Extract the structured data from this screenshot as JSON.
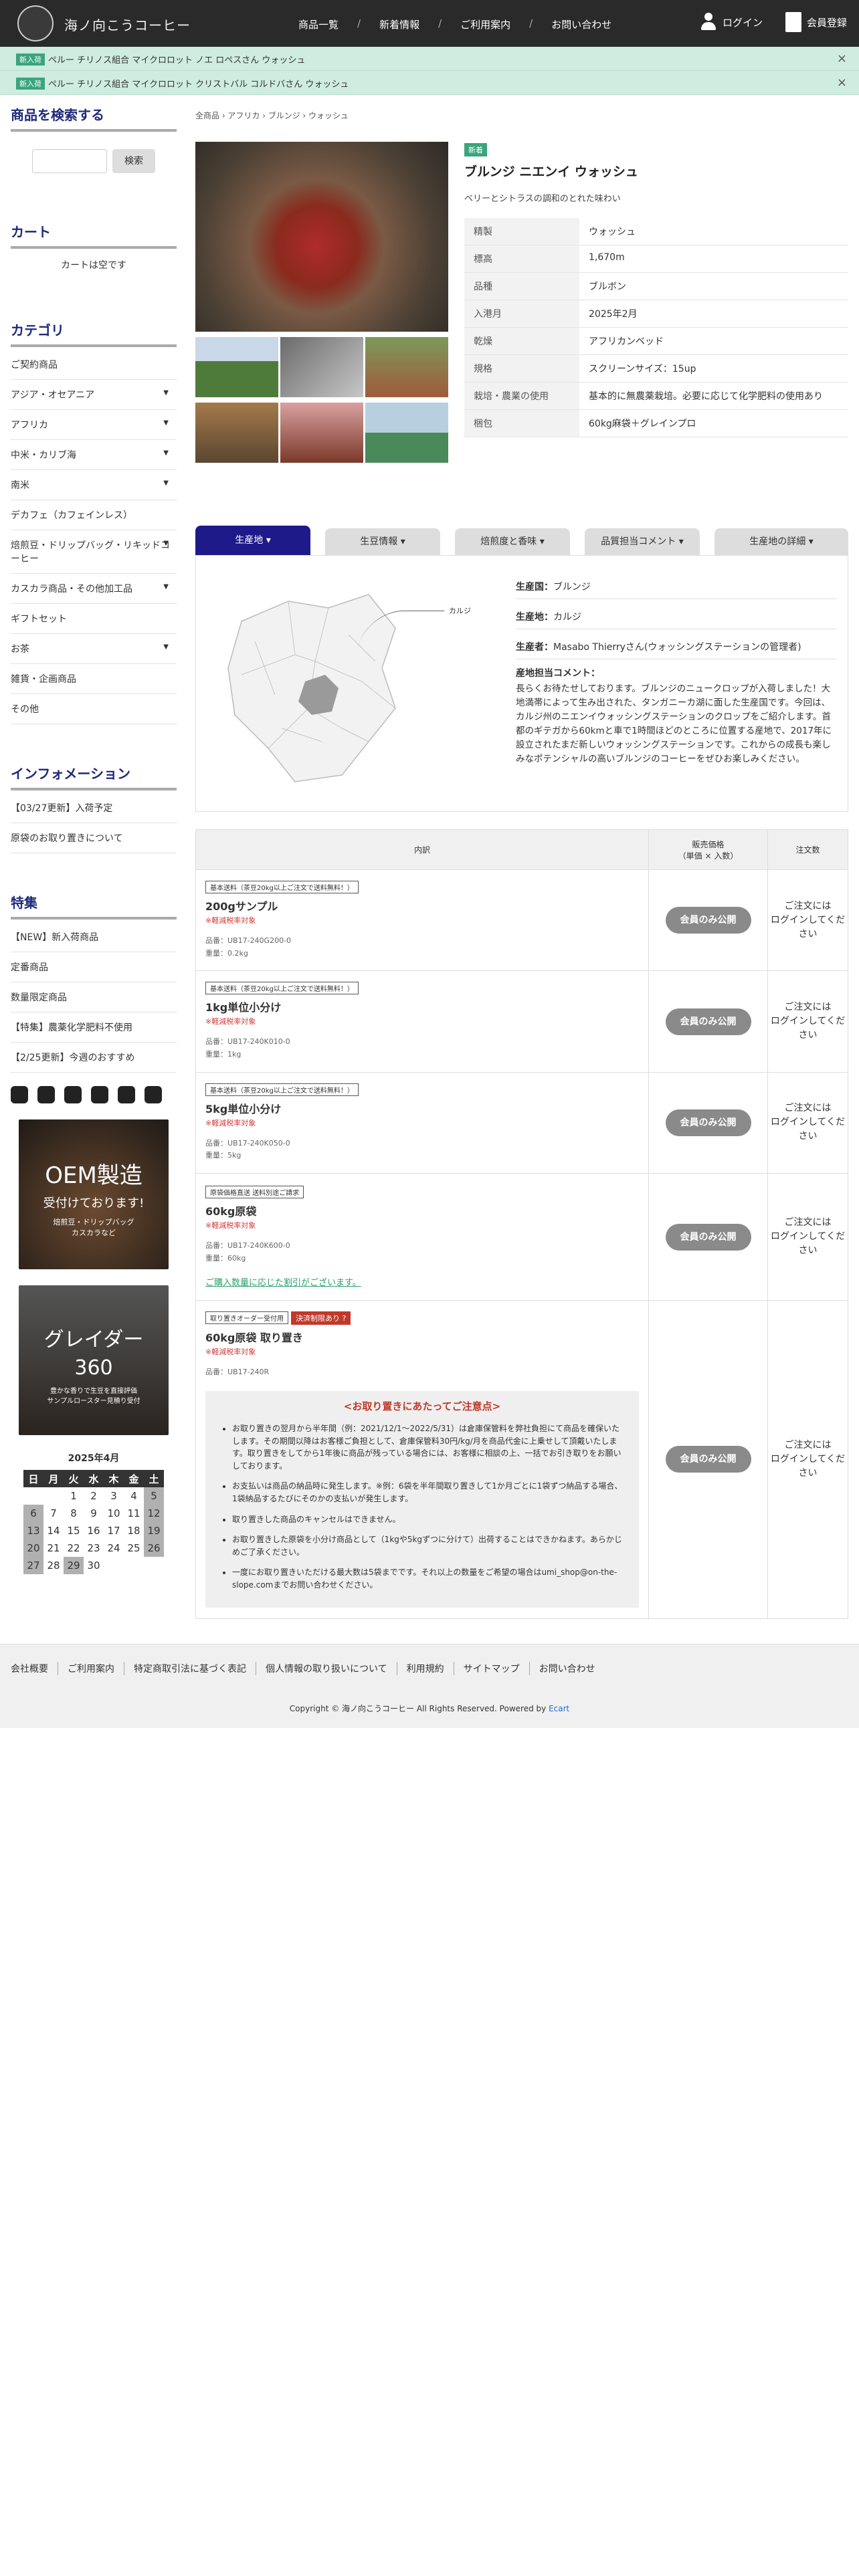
{
  "header": {
    "logo_text": "海ノ向こうコーヒー",
    "nav": [
      "商品一覧",
      "新着情報",
      "ご利用案内",
      "お問い合わせ"
    ],
    "login": "ログイン",
    "register": "会員登録"
  },
  "notices": [
    {
      "tag": "新入荷",
      "text": "ペルー チリノス組合 マイクロロット ノエ ロペスさん ウォッシュ"
    },
    {
      "tag": "新入荷",
      "text": "ペルー チリノス組合 マイクロロット クリストバル コルドバさん ウォッシュ"
    }
  ],
  "sidebar": {
    "search_title": "商品を検索する",
    "search_button": "検索",
    "cart_title": "カート",
    "cart_empty": "カートは空です",
    "category_title": "カテゴリ",
    "categories": [
      {
        "label": "ご契約商品",
        "arrow": ""
      },
      {
        "label": "アジア・オセアニア",
        "arrow": "▼"
      },
      {
        "label": "アフリカ",
        "arrow": "▼"
      },
      {
        "label": "中米・カリブ海",
        "arrow": "▼"
      },
      {
        "label": "南米",
        "arrow": "▼"
      },
      {
        "label": "デカフェ（カフェインレス）",
        "arrow": ""
      },
      {
        "label": "焙煎豆・ドリップバッグ・リキッドコーヒー",
        "arrow": "▼"
      },
      {
        "label": "カスカラ商品・その他加工品",
        "arrow": "▼"
      },
      {
        "label": "ギフトセット",
        "arrow": ""
      },
      {
        "label": "お茶",
        "arrow": "▼"
      },
      {
        "label": "雑貨・企画商品",
        "arrow": ""
      },
      {
        "label": "その他",
        "arrow": ""
      }
    ],
    "info_title": "インフォメーション",
    "info": [
      "【03/27更新】入荷予定",
      "原袋のお取り置きについて"
    ],
    "feature_title": "特集",
    "features": [
      "【NEW】新入荷商品",
      "定番商品",
      "数量限定商品",
      "【特集】農薬化学肥料不使用",
      "【2/25更新】今週のおすすめ"
    ],
    "sns": [
      "instagram-icon",
      "facebook-icon",
      "line-icon",
      "youtube-icon",
      "podcast-icon",
      "leaf-icon"
    ],
    "banner1": {
      "big": "OEM製造",
      "mid": "受付けております!",
      "sm": "焙煎豆・ドリップバッグ\nカスカラなど"
    },
    "banner2": {
      "big": "グレイダー",
      "mid": "360",
      "sm": "豊かな香りで生豆を直接評価\nサンプルロースター見積り受付"
    },
    "calendar": {
      "title": "2025年4月",
      "days": [
        "日",
        "月",
        "火",
        "水",
        "木",
        "金",
        "土"
      ],
      "weeks": [
        [
          "",
          "",
          "1",
          "2",
          "3",
          "4",
          "5"
        ],
        [
          "6",
          "7",
          "8",
          "9",
          "10",
          "11",
          "12"
        ],
        [
          "13",
          "14",
          "15",
          "16",
          "17",
          "18",
          "19"
        ],
        [
          "20",
          "21",
          "22",
          "23",
          "24",
          "25",
          "26"
        ],
        [
          "27",
          "28",
          "29",
          "30",
          "",
          "",
          ""
        ]
      ],
      "holidays": [
        "5",
        "6",
        "12",
        "13",
        "19",
        "20",
        "26",
        "27",
        "29"
      ]
    }
  },
  "breadcrumb": "全商品 › アフリカ › ブルンジ › ウォッシュ",
  "product": {
    "badge": "新着",
    "title": "ブルンジ ニエンイ ウォッシュ",
    "subtitle": "ベリーとシトラスの調和のとれた味わい",
    "specs": [
      {
        "k": "精製",
        "v": "ウォッシュ"
      },
      {
        "k": "標高",
        "v": "1,670m"
      },
      {
        "k": "品種",
        "v": "ブルボン"
      },
      {
        "k": "入港月",
        "v": "2025年2月"
      },
      {
        "k": "乾燥",
        "v": "アフリカンベッド"
      },
      {
        "k": "規格",
        "v": "スクリーンサイズ：15up"
      },
      {
        "k": "栽培・農業の使用",
        "v": "基本的に無農薬栽培。必要に応じて化学肥料の使用あり"
      },
      {
        "k": "梱包",
        "v": "60kg麻袋＋グレインプロ"
      }
    ]
  },
  "tabs": [
    "生産地 ▾",
    "生豆情報 ▾",
    "焙煎度と香味 ▾",
    "品質担当コメント ▾",
    "生産地の詳細 ▾"
  ],
  "origin": {
    "country_label": "生産国：",
    "country": "ブルンジ",
    "region_label": "生産地：",
    "region": "カルジ",
    "producer_label": "生産者：",
    "producer": "Masabo Thierryさん(ウォッシングステーションの管理者)",
    "comment_label": "産地担当コメント：",
    "comment": "長らくお待たせしております。ブルンジのニュークロップが入荷しました！大地満帯によって生み出された、タンガニーカ湖に面した生産国です。今回は、カルジ州のニエンイウォッシングステーションのクロップをご紹介します。首都のギテガから60kmと車で1時間ほどのところに位置する産地で、2017年に設立されたまだ新しいウォッシングステーションです。これからの成長も楽しみなポテンシャルの高いブルンジのコーヒーをぜひお楽しみください。",
    "map_label": "カルジ"
  },
  "price_table": {
    "headers": [
      "内訳",
      "販売価格\n（単価 × 入数）",
      "注文数"
    ],
    "rows": [
      {
        "tags": [
          "基本送料（茶豆20kg以上ご注文で送料無料！）"
        ],
        "name": "200gサンプル",
        "red": "※軽減税率対象",
        "sku": [
          "品番：UB17-240G200-0",
          "重量：0.2kg"
        ],
        "note": ""
      },
      {
        "tags": [
          "基本送料（茶豆20kg以上ご注文で送料無料！）"
        ],
        "name": "1kg単位小分け",
        "red": "※軽減税率対象",
        "sku": [
          "品番：UB17-240K010-0",
          "重量：1kg"
        ],
        "note": ""
      },
      {
        "tags": [
          "基本送料（茶豆20kg以上ご注文で送料無料！）"
        ],
        "name": "5kg単位小分け",
        "red": "※軽減税率対象",
        "sku": [
          "品番：UB17-240K050-0",
          "重量：5kg"
        ],
        "note": ""
      },
      {
        "tags": [
          "原袋価格直送 送料別途ご請求"
        ],
        "name": "60kg原袋",
        "red": "※軽減税率対象",
        "sku": [
          "品番：UB17-240K600-0",
          "重量：60kg"
        ],
        "note": "ご購入数量に応じた割引がございます。"
      }
    ],
    "reserve": {
      "tags": [
        "取り置きオーダー受付用",
        "決済制限あり ?"
      ],
      "name": "60kg原袋 取り置き",
      "red": "※軽減税率対象",
      "sku": [
        "品番：UB17-240R"
      ],
      "caution_title": "<お取り置きにあたってご注意点>",
      "caution": [
        "お取り置きの翌月から半年間（例：2021/12/1〜2022/5/31）は倉庫保管料を弊社負担にて商品を確保いたします。その期間以降はお客様ご負担として、倉庫保管料30円/kg/月を商品代金に上乗せして頂戴いたします。取り置きをしてから1年後に商品が残っている場合には、お客様に相談の上、一括でお引き取りをお願いしております。",
        "お支払いは商品の納品時に発生します。※例：6袋を半年間取り置きして1か月ごとに1袋ずつ納品する場合、1袋納品するたびにそのかの支払いが発生します。",
        "取り置きした商品のキャンセルはできません。",
        "お取り置きした原袋を小分け商品として（1kgや5kgずつに分けて）出荷することはできかねます。あらかじめご了承ください。",
        "一度にお取り置きいただける最大数は5袋までです。それ以上の数量をご希望の場合はumi_shop@on-the-slope.comまでお問い合わせください。"
      ]
    },
    "member_button": "会員のみ公開",
    "login_note": "ご注文には\nログインしてください"
  },
  "footer": {
    "links": [
      "会社概要",
      "ご利用案内",
      "特定商取引法に基づく表記",
      "個人情報の取り扱いについて",
      "利用規約",
      "サイトマップ",
      "お問い合わせ"
    ],
    "copyright": "Copyright © 海ノ向こうコーヒー All Rights Reserved. Powered by ",
    "powered": "Ecart"
  }
}
